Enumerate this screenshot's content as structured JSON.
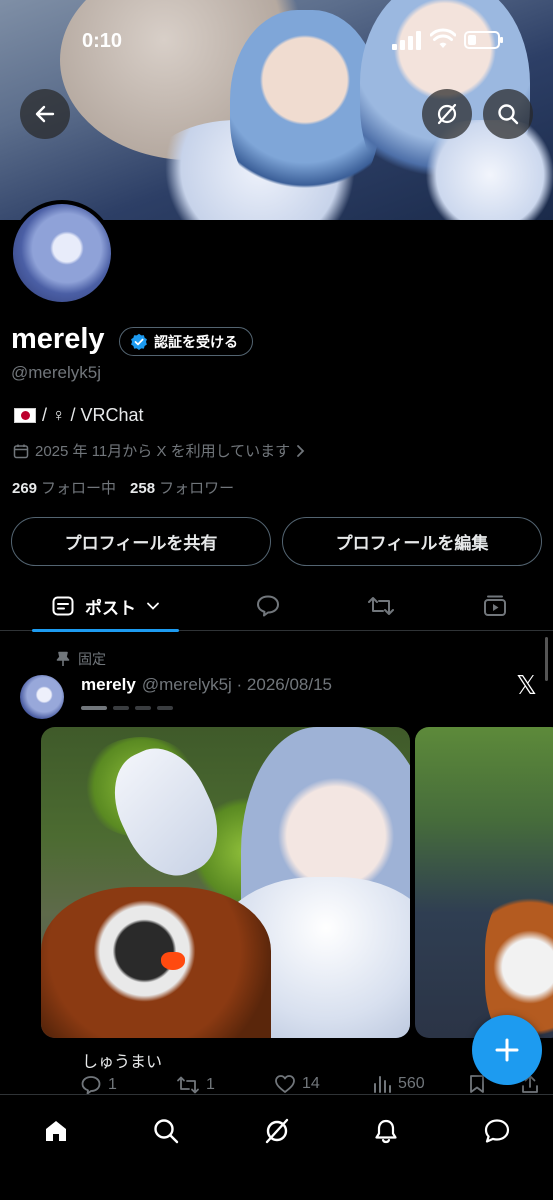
{
  "status_bar": {
    "time": "0:10"
  },
  "profile": {
    "name": "merely",
    "verify_label": "認証を受ける",
    "handle": "@merelyk5j",
    "bio": "/ ♀ / VRChat",
    "joined": "2025 年 11月から X を利用しています",
    "following_count": "269",
    "following_label": "フォロー中",
    "followers_count": "258",
    "followers_label": "フォロワー",
    "share_button": "プロフィールを共有",
    "edit_button": "プロフィールを編集"
  },
  "tabs": {
    "posts_label": "ポスト"
  },
  "post": {
    "pinned_label": "固定",
    "author": "merely",
    "handle_date": "@merelyk5j · 2026/08/15",
    "caption": "しゅうまい",
    "replies": "1",
    "reposts": "1",
    "likes": "14",
    "views": "560"
  },
  "colors": {
    "accent": "#1d9bf0",
    "muted": "#71767b",
    "border": "#536471"
  }
}
